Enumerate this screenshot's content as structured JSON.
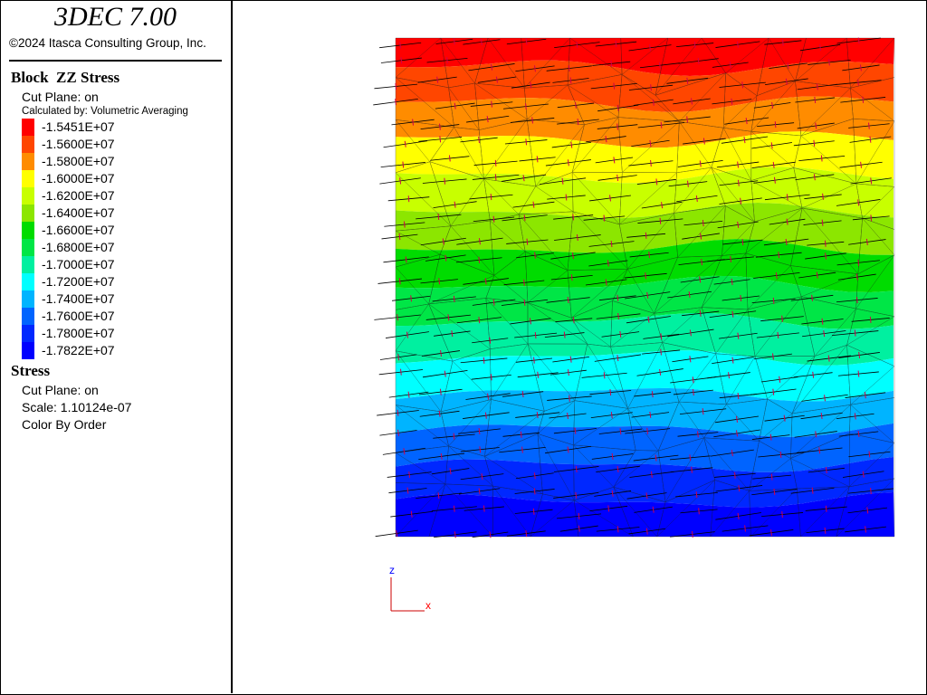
{
  "app": {
    "title": "3DEC 7.00",
    "copyright": "©2024 Itasca Consulting Group, Inc."
  },
  "block_stress": {
    "title": "Block  ZZ Stress",
    "cut_plane": "Cut Plane: on",
    "calculated_by": "Calculated by:  Volumetric Averaging",
    "contours": [
      {
        "label": "-1.5451E+07",
        "color": "#ff0000"
      },
      {
        "label": "-1.5600E+07",
        "color": "#ff4600"
      },
      {
        "label": "-1.5800E+07",
        "color": "#ff8c00"
      },
      {
        "label": "-1.6000E+07",
        "color": "#ffff00"
      },
      {
        "label": "-1.6200E+07",
        "color": "#c8ff00"
      },
      {
        "label": "-1.6400E+07",
        "color": "#8ce600"
      },
      {
        "label": "-1.6600E+07",
        "color": "#00dc00"
      },
      {
        "label": "-1.6800E+07",
        "color": "#00e646"
      },
      {
        "label": "-1.7000E+07",
        "color": "#00f0a0"
      },
      {
        "label": "-1.7200E+07",
        "color": "#00ffff"
      },
      {
        "label": "-1.7400E+07",
        "color": "#00b4ff"
      },
      {
        "label": "-1.7600E+07",
        "color": "#0064ff"
      },
      {
        "label": "-1.7800E+07",
        "color": "#0028ff"
      },
      {
        "label": "-1.7822E+07",
        "color": "#0000ff"
      }
    ]
  },
  "stress": {
    "title": "Stress",
    "cut_plane": "Cut Plane: on",
    "scale": "Scale: 1.10124e-07",
    "color": "Color By Order"
  },
  "axes": {
    "z_label": "z",
    "x_label": "x",
    "z_color": "#0000ff",
    "x_color": "#ff0000",
    "axis_color": "#cc0000"
  }
}
